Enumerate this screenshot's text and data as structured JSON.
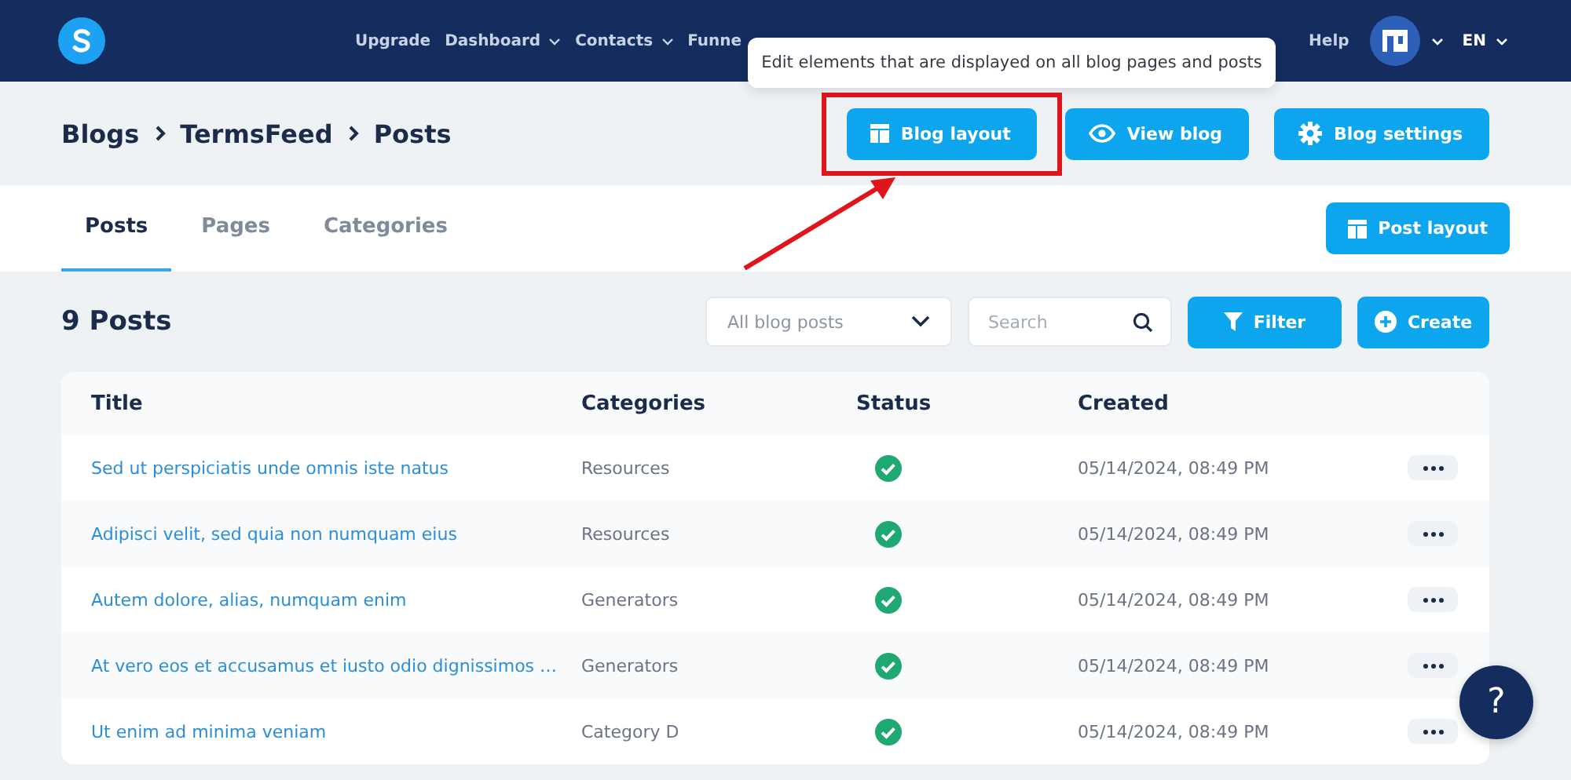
{
  "nav": {
    "items": [
      {
        "label": "Upgrade",
        "dropdown": false
      },
      {
        "label": "Dashboard",
        "dropdown": true
      },
      {
        "label": "Contacts",
        "dropdown": true
      },
      {
        "label": "Funne",
        "dropdown": false
      }
    ],
    "help": "Help",
    "language": "EN"
  },
  "tooltip": "Edit elements that are displayed on all blog pages and posts",
  "breadcrumb": [
    "Blogs",
    "TermsFeed",
    "Posts"
  ],
  "header_buttons": [
    {
      "label": "Blog layout",
      "highlighted": true
    },
    {
      "label": "View blog",
      "highlighted": false
    },
    {
      "label": "Blog settings",
      "highlighted": false
    }
  ],
  "tabs": [
    {
      "label": "Posts",
      "selected": true
    },
    {
      "label": "Pages",
      "selected": false
    },
    {
      "label": "Categories",
      "selected": false
    }
  ],
  "post_layout_button": "Post layout",
  "posts_title": "9 Posts",
  "filter_select": "All blog posts",
  "search": {
    "placeholder": "Search"
  },
  "filter_button": "Filter",
  "create_button": "Create",
  "table": {
    "columns": [
      "Title",
      "Categories",
      "Status",
      "Created"
    ],
    "rows": [
      {
        "title": "Sed ut perspiciatis unde omnis iste natus",
        "category": "Resources",
        "published": true,
        "created": "05/14/2024, 08:49 PM"
      },
      {
        "title": "Adipisci velit, sed quia non numquam eius",
        "category": "Resources",
        "published": true,
        "created": "05/14/2024, 08:49 PM"
      },
      {
        "title": "Autem dolore, alias, numquam enim",
        "category": "Generators",
        "published": true,
        "created": "05/14/2024, 08:49 PM"
      },
      {
        "title": "At vero eos et accusamus et iusto odio dignissimos …",
        "category": "Generators",
        "published": true,
        "created": "05/14/2024, 08:49 PM"
      },
      {
        "title": "Ut enim ad minima veniam",
        "category": "Category D",
        "published": true,
        "created": "05/14/2024, 08:49 PM"
      }
    ]
  },
  "help_button": "?"
}
